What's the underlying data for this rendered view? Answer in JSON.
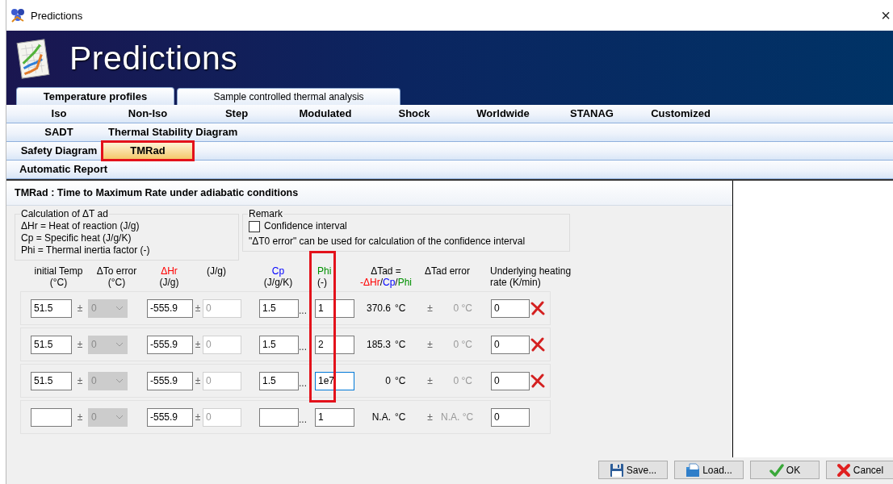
{
  "window": {
    "title": "Predictions",
    "close_glyph": "×"
  },
  "banner": {
    "title": "Predictions"
  },
  "top_tabs": [
    {
      "label": "Temperature profiles",
      "selected": true
    },
    {
      "label": "Sample controlled thermal analysis",
      "selected": false
    }
  ],
  "method_tab_rows": [
    {
      "tabs": [
        {
          "label": "Iso",
          "selected": false,
          "highlighted": false
        },
        {
          "label": "Non-Iso",
          "selected": false,
          "highlighted": false
        },
        {
          "label": "Step",
          "selected": false,
          "highlighted": false
        },
        {
          "label": "Modulated",
          "selected": false,
          "highlighted": false
        },
        {
          "label": "Shock",
          "selected": false,
          "highlighted": false
        },
        {
          "label": "Worldwide",
          "selected": false,
          "highlighted": false
        },
        {
          "label": "STANAG",
          "selected": false,
          "highlighted": false
        },
        {
          "label": "Customized",
          "selected": false,
          "highlighted": false
        }
      ]
    },
    {
      "tabs": [
        {
          "label": "SADT",
          "selected": false,
          "highlighted": false
        },
        {
          "label": "Thermal Stability Diagram",
          "selected": false,
          "highlighted": false
        }
      ]
    },
    {
      "tabs": [
        {
          "label": "Safety Diagram",
          "selected": false,
          "highlighted": false
        },
        {
          "label": "TMRad",
          "selected": true,
          "highlighted": true
        }
      ]
    },
    {
      "tabs": [
        {
          "label": "Automatic Report",
          "selected": false,
          "highlighted": false
        }
      ]
    }
  ],
  "panel": {
    "title": "TMRad : Time to Maximum Rate under adiabatic conditions",
    "calculation_group": {
      "title": "Calculation of ΔT ad",
      "lines": [
        "ΔHr = Heat of reaction (J/g)",
        "Cp = Specific heat (J/g/K)",
        "Phi = Thermal inertia factor (-)"
      ]
    },
    "remark_group": {
      "title": "Remark",
      "checkbox": {
        "label": "Confidence interval",
        "checked": false
      },
      "note": "\"ΔT0 error\" can be used for calculation of the confidence interval"
    },
    "columns": [
      {
        "lines": [
          [
            {
              "text": "initial Temp"
            }
          ],
          [
            {
              "text": "(°C)"
            }
          ]
        ],
        "highlighted": false
      },
      {
        "lines": [
          [
            {
              "text": "ΔTo error"
            }
          ],
          [
            {
              "text": "(°C)"
            }
          ]
        ],
        "highlighted": false
      },
      {
        "lines": [
          [
            {
              "text": "ΔHr",
              "color": "#ff0000"
            }
          ],
          [
            {
              "text": "(J/g)"
            }
          ]
        ],
        "highlighted": false
      },
      {
        "lines": [
          [
            {
              "text": "(J/g)"
            }
          ]
        ],
        "highlighted": false
      },
      {
        "lines": [
          [
            {
              "text": "Cp",
              "color": "#0000ff"
            }
          ],
          [
            {
              "text": "(J/g/K)"
            }
          ]
        ],
        "highlighted": false
      },
      {
        "lines": [
          [
            {
              "text": "Phi",
              "color": "#009000"
            }
          ],
          [
            {
              "text": "(-)"
            }
          ]
        ],
        "highlighted": true
      },
      {
        "lines": [
          [
            {
              "text": "ΔTad ="
            }
          ],
          [
            {
              "text": "-ΔHr",
              "color": "#ff0000"
            },
            {
              "text": "/"
            },
            {
              "text": "Cp",
              "color": "#0000ff"
            },
            {
              "text": "/"
            },
            {
              "text": "Phi",
              "color": "#009000"
            }
          ]
        ],
        "highlighted": false
      },
      {
        "lines": [
          [
            {
              "text": "ΔTad error"
            }
          ]
        ],
        "highlighted": false
      },
      {
        "lines": [
          [
            {
              "text": "Underlying heating"
            }
          ],
          [
            {
              "text": "rate (K/min)"
            }
          ]
        ],
        "highlighted": false
      }
    ],
    "rows": [
      {
        "initial_temp": "51.5",
        "temp_pm": "±",
        "temp_error": "0",
        "temp_error_disabled": true,
        "hr": "-555.9",
        "hr_pm": "±",
        "hr_error": "0",
        "hr_error_disabled": true,
        "cp": "1.5",
        "cp_more": "...",
        "phi": "1",
        "phi_focused": false,
        "dtad": "370.6",
        "dtad_unit": "°C",
        "dtad_pm": "±",
        "dtad_error": "0 °C",
        "rate": "0",
        "deletable": true
      },
      {
        "initial_temp": "51.5",
        "temp_pm": "±",
        "temp_error": "0",
        "temp_error_disabled": true,
        "hr": "-555.9",
        "hr_pm": "±",
        "hr_error": "0",
        "hr_error_disabled": true,
        "cp": "1.5",
        "cp_more": "...",
        "phi": "2",
        "phi_focused": false,
        "dtad": "185.3",
        "dtad_unit": "°C",
        "dtad_pm": "±",
        "dtad_error": "0 °C",
        "rate": "0",
        "deletable": true
      },
      {
        "initial_temp": "51.5",
        "temp_pm": "±",
        "temp_error": "0",
        "temp_error_disabled": true,
        "hr": "-555.9",
        "hr_pm": "±",
        "hr_error": "0",
        "hr_error_disabled": true,
        "cp": "1.5",
        "cp_more": "...",
        "phi": "1e7",
        "phi_focused": true,
        "dtad": "0",
        "dtad_unit": "°C",
        "dtad_pm": "±",
        "dtad_error": "0 °C",
        "rate": "0",
        "deletable": true
      },
      {
        "initial_temp": "",
        "temp_pm": "±",
        "temp_error": "0",
        "temp_error_disabled": true,
        "hr": "-555.9",
        "hr_pm": "±",
        "hr_error": "0",
        "hr_error_disabled": true,
        "cp": "",
        "cp_more": "...",
        "phi": "1",
        "phi_focused": false,
        "dtad": "N.A.",
        "dtad_unit": "°C",
        "dtad_pm": "±",
        "dtad_error": "N.A. °C",
        "rate": "0",
        "deletable": false
      }
    ]
  },
  "buttons": [
    {
      "kind": "save",
      "label": "Save..."
    },
    {
      "kind": "load",
      "label": "Load..."
    },
    {
      "kind": "ok",
      "label": "OK"
    },
    {
      "kind": "cancel",
      "label": "Cancel"
    }
  ]
}
